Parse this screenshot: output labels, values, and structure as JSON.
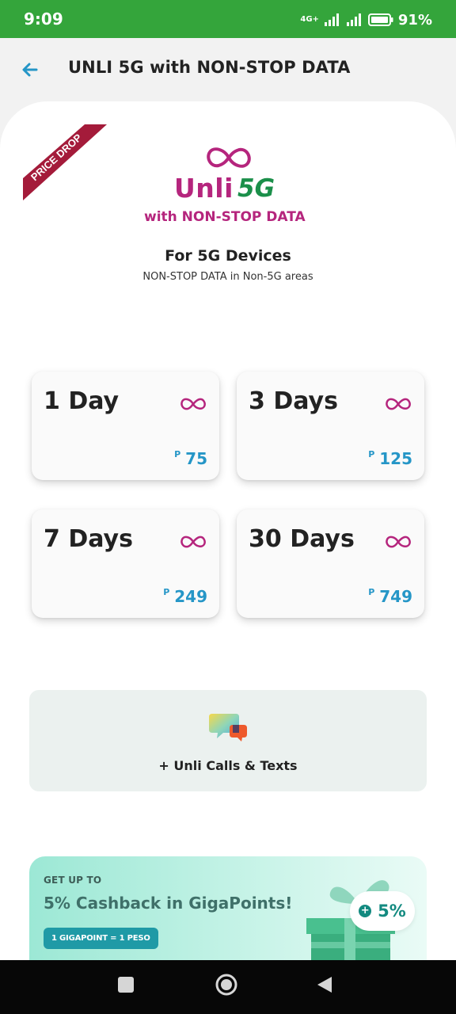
{
  "status_bar": {
    "time": "9:09",
    "network": "4G+",
    "battery": "91%"
  },
  "header": {
    "title": "UNLI 5G with NON-STOP DATA",
    "back_icon": "arrow-left-icon"
  },
  "hero": {
    "ribbon_text": "PRICE DROP",
    "brand_word": "Unli",
    "brand_5g": "5G",
    "brand_sub": "with NON-STOP DATA",
    "devices_title": "For 5G Devices",
    "devices_sub": "NON-STOP DATA in Non-5G areas"
  },
  "plans": [
    {
      "name": "1 Day",
      "currency": "P",
      "price": "75"
    },
    {
      "name": "3 Days",
      "currency": "P",
      "price": "125"
    },
    {
      "name": "7 Days",
      "currency": "P",
      "price": "249"
    },
    {
      "name": "30 Days",
      "currency": "P",
      "price": "749"
    }
  ],
  "calls": {
    "label": "+ Unli Calls & Texts",
    "icon": "chat-bubbles-icon"
  },
  "cashback": {
    "eyebrow": "GET UP TO",
    "title": "5% Cashback in GigaPoints!",
    "badge": "1 GIGAPOINT = 1 PESO",
    "percent": "5%"
  },
  "colors": {
    "status_green": "#34a53b",
    "brand_magenta": "#b5257d",
    "brand_green": "#1b8f4a",
    "price_blue": "#2596c7",
    "teal": "#1f9aa6"
  }
}
